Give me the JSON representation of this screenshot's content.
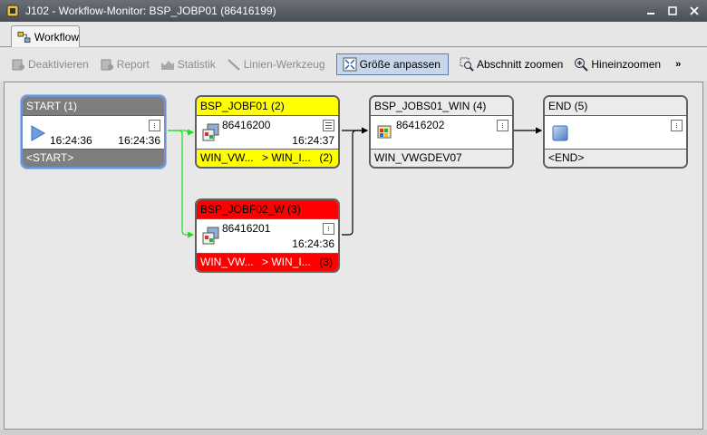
{
  "window": {
    "title": "J102 - Workflow-Monitor: BSP_JOBP01 (86416199)",
    "icon": "job-plan-icon",
    "buttons": [
      "minimize-icon",
      "maximize-icon",
      "close-icon"
    ]
  },
  "tabs": [
    {
      "label": "Workflow",
      "icon": "workflow-icon"
    }
  ],
  "toolbar": {
    "deactivate": "Deaktivieren",
    "report": "Report",
    "statistics": "Statistik",
    "line_tool": "Linien-Werkzeug",
    "fit_size": "Größe anpassen",
    "zoom_section": "Abschnitt zoomen",
    "zoom_in": "Hineinzoomen",
    "more": "»"
  },
  "nodes": {
    "start": {
      "header": "START (1)",
      "time_left": "16:24:36",
      "time_right": "16:24:36",
      "footer": "<START>",
      "color": "#7e7e7e"
    },
    "jobf01": {
      "header": "BSP_JOBF01 (2)",
      "run_id": "86416200",
      "time": "16:24:37",
      "footer_left": "WIN_VW...",
      "footer_mid": "> WIN_I...",
      "footer_right": "(2)",
      "color": "#ffff00"
    },
    "jobf02": {
      "header": "BSP_JOBF02_W (3)",
      "run_id": "86416201",
      "time": "16:24:36",
      "footer_left": "WIN_VW...",
      "footer_mid": "> WIN_I...",
      "footer_right": "(3)",
      "color": "#ff0000"
    },
    "jobs01": {
      "header": "BSP_JOBS01_WIN (4)",
      "run_id": "86416202",
      "footer": "WIN_VWGDEV07",
      "color": "#ebebeb"
    },
    "end": {
      "header": "END (5)",
      "footer": "<END>",
      "color": "#ebebeb"
    }
  },
  "edge_colors": {
    "green": "#22dd22",
    "black": "#000000"
  }
}
